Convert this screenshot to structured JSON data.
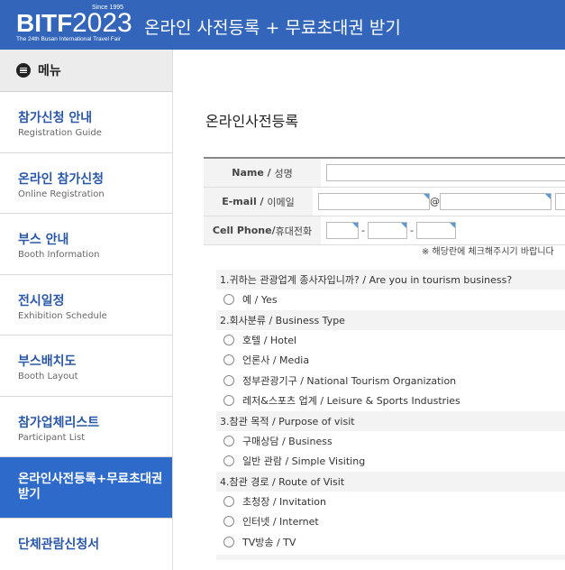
{
  "header": {
    "logo": {
      "since": "Since 1995",
      "brand": "BITF",
      "year": "2023",
      "sub": "The 24th Busan International Travel Fair"
    },
    "title": "온라인 사전등록 + 무료초대권 받기",
    "color": "#3366bb"
  },
  "sidebar": {
    "menu_label": "메뉴",
    "items": [
      {
        "ko": "참가신청 안내",
        "en": "Registration Guide"
      },
      {
        "ko": "온라인 참가신청",
        "en": "Online Registration"
      },
      {
        "ko": "부스 안내",
        "en": "Booth Information"
      },
      {
        "ko": "전시일정",
        "en": "Exhibition Schedule"
      },
      {
        "ko": "부스배치도",
        "en": "Booth Layout"
      },
      {
        "ko": "참가업체리스트",
        "en": "Participant List"
      },
      {
        "ko": "온라인사전등록+무료초대권 받기",
        "en": ""
      },
      {
        "ko": "단체관람신청서",
        "en": ""
      }
    ],
    "active_color": "#2e6ac9"
  },
  "main": {
    "page_title": "온라인사전등록",
    "form": {
      "name_label_en": "Name / ",
      "name_label_ko": "성명",
      "email_label_en": "E-mail / ",
      "email_label_ko": "이메일",
      "email_at": "@",
      "phone_label_en": "Cell Phone/",
      "phone_label_ko": "휴대전화",
      "phone_sep": "-"
    },
    "notice": "※ 해당란에 체크해주시기 바랍니다",
    "survey": {
      "q1": "1.귀하는 관광업계 종사자입니까? / Are you in tourism business?",
      "q1_options": [
        "예 / Yes"
      ],
      "q2": "2.회사분류 / Business Type",
      "q2_options": [
        "호텔 / Hotel",
        "언론사 / Media",
        "정부관광기구 / National Tourism Organization",
        "레저&스포츠 업계 / Leisure & Sports Industries"
      ],
      "q3": "3.참관 목적 / Purpose of visit",
      "q3_options": [
        "구매상담 / Business",
        "일반 관람 / Simple Visiting"
      ],
      "q4": "4.참관 경로 / Route of Visit",
      "q4_options": [
        "초청장 / Invitation",
        "인터넷 / Internet",
        "TV방송 / TV"
      ]
    }
  }
}
